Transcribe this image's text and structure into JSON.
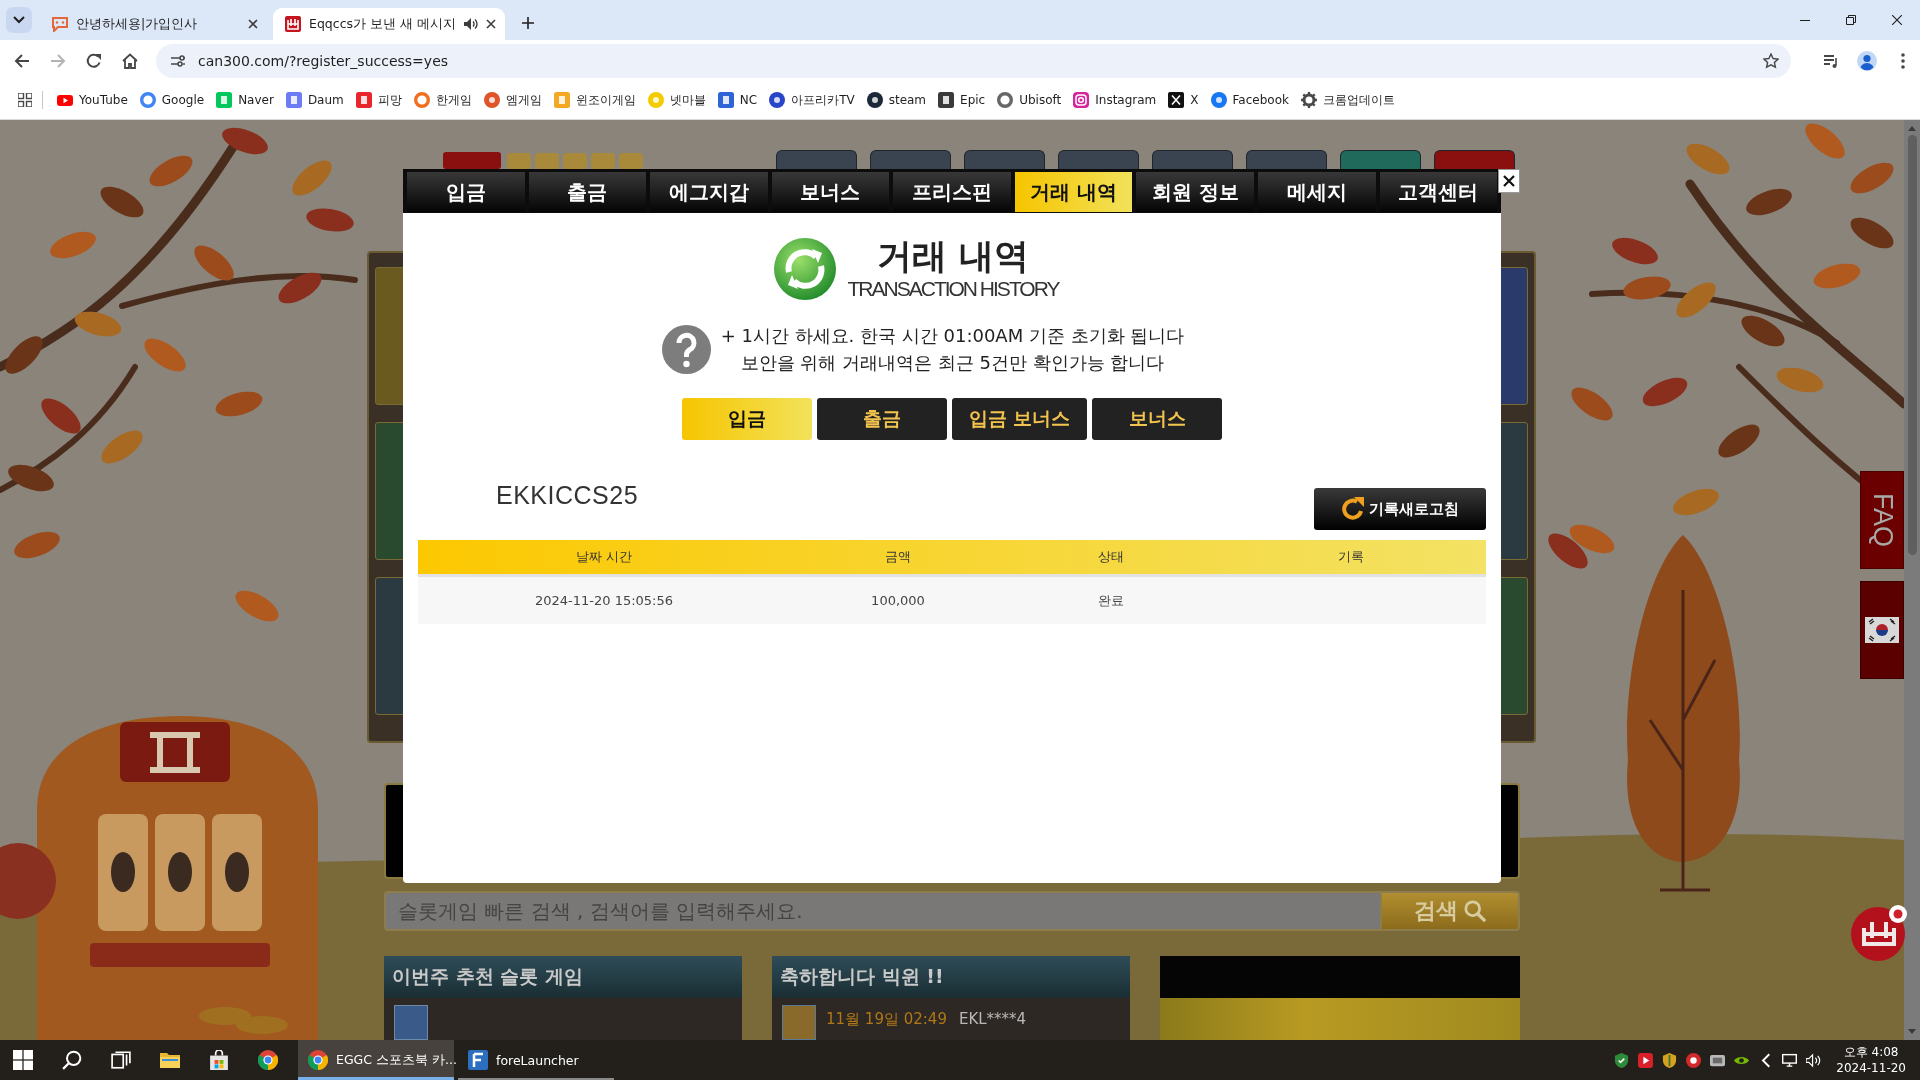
{
  "browser": {
    "tabs": [
      {
        "title": "안녕하세용|가입인사",
        "selected": false,
        "audio": false
      },
      {
        "title": "Eqqccs가 보낸 새 메시지",
        "selected": true,
        "audio": true
      }
    ],
    "forward_disabled": true,
    "address": "can300.com/?register_success=yes",
    "bookmarks": [
      {
        "label": "YouTube"
      },
      {
        "label": "Google"
      },
      {
        "label": "Naver"
      },
      {
        "label": "Daum"
      },
      {
        "label": "피망"
      },
      {
        "label": "한게임"
      },
      {
        "label": "엠게임"
      },
      {
        "label": "윈조이게임"
      },
      {
        "label": "넷마블"
      },
      {
        "label": "NC"
      },
      {
        "label": "아프리카TV"
      },
      {
        "label": "steam"
      },
      {
        "label": "Epic"
      },
      {
        "label": "Ubisoft"
      },
      {
        "label": "Instagram"
      },
      {
        "label": "X"
      },
      {
        "label": "Facebook"
      },
      {
        "label": "크롬업데이트"
      }
    ]
  },
  "page": {
    "search": {
      "placeholder": "슬롯게임 빠른 검색 , 검색어를 입력해주세요.",
      "button": "검색"
    },
    "sections": [
      {
        "kind": "games",
        "title": "이번주 추천 슬롯 게임"
      },
      {
        "kind": "wins",
        "title": "축하합니다 빅윈 !!",
        "wins": [
          {
            "time": "11월 19일 02:49",
            "user": "EKL****4"
          }
        ]
      },
      {
        "kind": "banner"
      }
    ],
    "faq": "FAQ"
  },
  "modal": {
    "tabs": [
      {
        "label": "입금",
        "selected": false
      },
      {
        "label": "출금",
        "selected": false
      },
      {
        "label": "에그지갑",
        "selected": false
      },
      {
        "label": "보너스",
        "selected": false
      },
      {
        "label": "프리스핀",
        "selected": false
      },
      {
        "label": "거래 내역",
        "selected": true
      },
      {
        "label": "회원 정보",
        "selected": false
      },
      {
        "label": "메세지",
        "selected": false
      },
      {
        "label": "고객센터",
        "selected": false
      }
    ],
    "title": "거래 내역",
    "subtitle": "TRANSACTION HISTORY",
    "notice": [
      "+ 1시간 하세요. 한국 시간 01:00AM 기준 초기화 됩니다",
      "보안을 위해 거래내역은 최근 5건만 확인가능 합니다"
    ],
    "filters": [
      {
        "label": "입금",
        "selected": true
      },
      {
        "label": "출금",
        "selected": false
      },
      {
        "label": "입금 보너스",
        "selected": false
      },
      {
        "label": "보너스",
        "selected": false
      }
    ],
    "username": "EKKICCS25",
    "refresh_button": "기록새로고침",
    "table": {
      "columns": [
        "날짜 시간",
        "금액",
        "상태",
        "기록"
      ],
      "rows": [
        {
          "cells": [
            "2024-11-20 15:05:56",
            "100,000",
            "완료"
          ]
        }
      ]
    }
  },
  "taskbar": {
    "apps": [
      {
        "label": "EGGC 스포츠북 카...",
        "selected": true
      },
      {
        "label": "foreLauncher",
        "selected": false
      }
    ],
    "time": "오후 4:08",
    "date": "2024-11-20"
  }
}
